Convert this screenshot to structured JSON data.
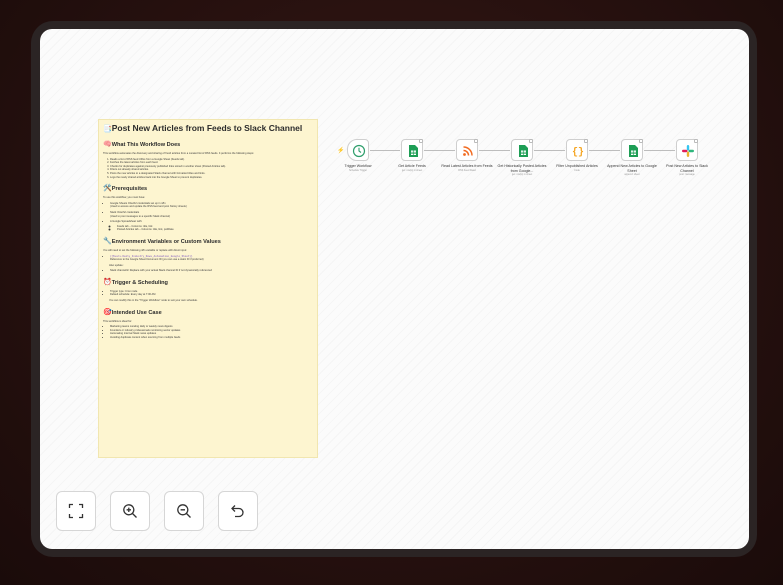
{
  "note": {
    "title": "Post New Articles from Feeds to Slack Channel",
    "s1": "What This Workflow Does",
    "s1_intro": "This workflow automates the discovery and sharing of fresh articles from a curated list of RSS feeds. It performs the following steps:",
    "s1_steps": [
      "Reads a list of RSS feed URLs from a Google Sheet (Feeds tab).",
      "Fetches the latest articles from each feed.",
      "Checks for duplicates against previously published links stored in another sheet (Posted Articles tab).",
      "Filters out already shared articles.",
      "Posts the new articles to a designated Slack channel with formatted titles and links.",
      "Logs the newly shared articles back into the Google Sheet to prevent duplicates."
    ],
    "s2": "Prerequisites",
    "s2_intro": "To use this workflow, you must have:",
    "s2_a": "Google Sheets OAuth2 credentials set up in n8n",
    "s2_a2": "(Used to access and update the RSS feed and post history sheets)",
    "s2_b": "Slack OAuth2 credentials",
    "s2_b2": "(Used to post messages to a specific Slack channel)",
    "s2_c": "A Google Spreadsheet with:",
    "s2_c1": "Feeds tab – Columns: title, link",
    "s2_c2": "Posted Articles tab – Columns: title, link, pubDate",
    "s3": "Environment Variables or Custom Values",
    "s3_intro": "You will need to set the following n8n variable or replace with direct input:",
    "s3_a": "{{$vars.Daily_Industry_News_Automation_Google_Sheet}}",
    "s3_a2": "Reference to the Google Sheet Document ID (you can use a static ID if preferred)",
    "s3_b": "Also update:",
    "s3_c": "Slack channelId: Replace with your actual Slack channel ID if not dynamically referenced",
    "s4": "Trigger & Scheduling",
    "s4_a": "Trigger type: Cron node",
    "s4_b": "Default schedule: Every day at 7:00 AM",
    "s4_c": "You can modify this in the \"Trigger Workflow\" node to suit your own schedule.",
    "s5": "Intended Use Case",
    "s5_intro": "This workflow is ideal for:",
    "s5_items": [
      "Marketing teams curating daily or weekly news digests",
      "Founders or industry professionals monitoring sector updates",
      "Automating internal Slack news updates",
      "Avoiding duplicate content when sourcing from multiple feeds"
    ]
  },
  "nodes": [
    {
      "title": "Trigger Workflow",
      "sub": "Schedule Trigger",
      "color": "#2e9e6b",
      "icon": "clock-icon"
    },
    {
      "title": "Get Article Feeds",
      "sub": "get: row(s) in sheet",
      "color": "#1e9e55",
      "icon": "google-sheets-icon"
    },
    {
      "title": "Read Latest Articles from Feeds",
      "sub": "RSS Feed Read",
      "color": "#f26b21",
      "icon": "rss-icon"
    },
    {
      "title": "Get Historically Posted Articles from Google...",
      "sub": "get: row(s) in sheet",
      "color": "#1e9e55",
      "icon": "google-sheets-icon"
    },
    {
      "title": "Filter Unpublished Articles",
      "sub": "Code",
      "color": "#f5a623",
      "icon": "code-icon"
    },
    {
      "title": "Append New Articles to Google Sheet",
      "sub": "append: sheet",
      "color": "#1e9e55",
      "icon": "google-sheets-icon"
    },
    {
      "title": "Post New Articles to Slack Channel",
      "sub": "post: message",
      "color": "#4a154b",
      "icon": "slack-icon"
    }
  ],
  "controls": [
    {
      "name": "fit-view-button",
      "icon": "fit-view-icon"
    },
    {
      "name": "zoom-in-button",
      "icon": "zoom-in-icon"
    },
    {
      "name": "zoom-out-button",
      "icon": "zoom-out-icon"
    },
    {
      "name": "reset-button",
      "icon": "undo-icon"
    }
  ]
}
